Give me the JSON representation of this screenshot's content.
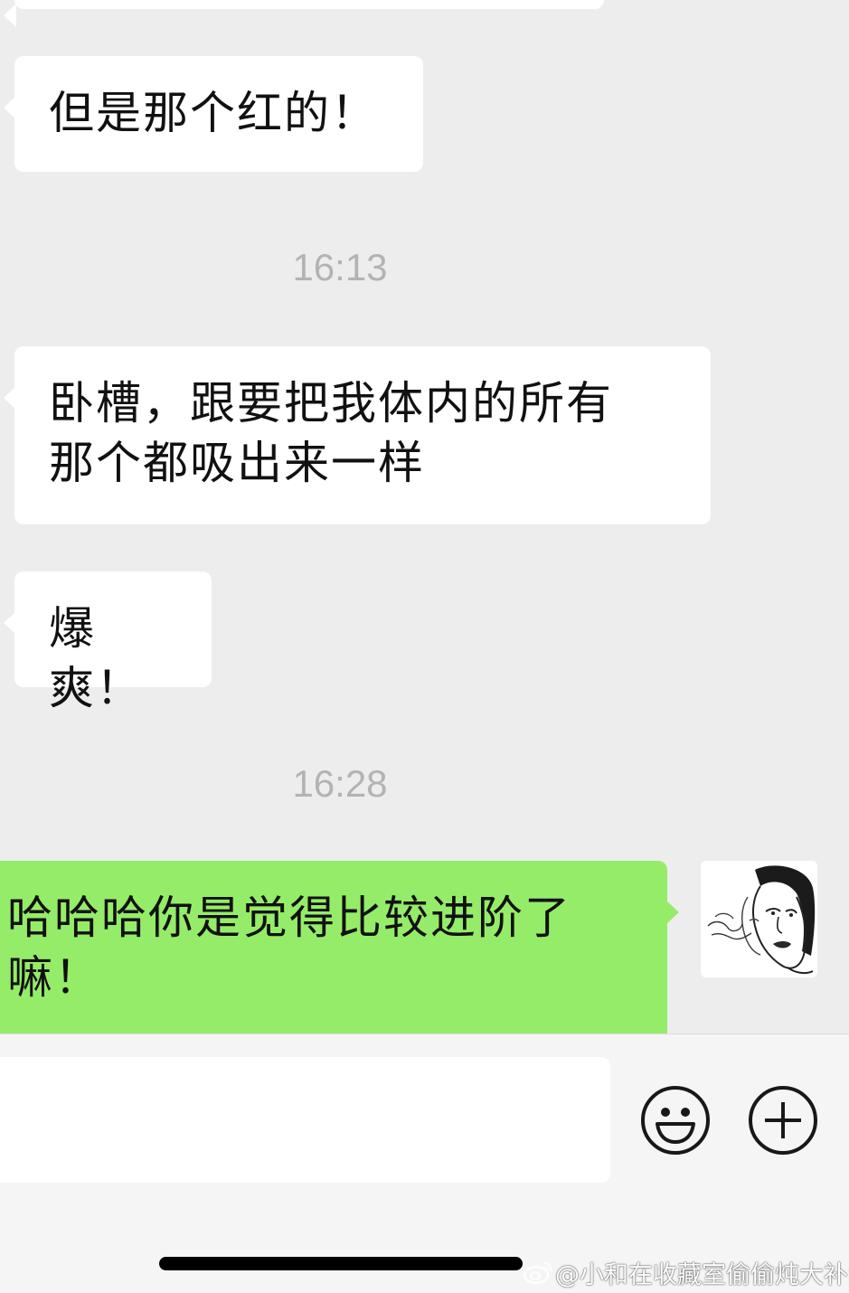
{
  "messages": [
    {
      "side": "in",
      "text": "但是那个红的！"
    },
    {
      "type": "time",
      "text": "16:13"
    },
    {
      "side": "in",
      "lines": [
        "卧槽，跟要把我体内的所有",
        "那个都吸出来一样"
      ]
    },
    {
      "side": "in",
      "text": "爆爽！"
    },
    {
      "type": "time",
      "text": "16:28"
    },
    {
      "side": "out",
      "lines": [
        "哈哈哈你是觉得比较进阶了",
        "嘛！"
      ]
    }
  ],
  "input": {
    "value": ""
  },
  "icons": {
    "emoji": "emoji-smile-icon",
    "plus": "plus-circle-icon",
    "avatar": "avatar-illustration"
  },
  "watermark": {
    "text": "@小和在收藏室偷偷炖大补汤"
  },
  "colors": {
    "background": "#ededed",
    "incoming_bubble": "#ffffff",
    "outgoing_bubble": "#95ec69",
    "timestamp": "#b3b3b3",
    "input_bar": "#f5f5f5"
  }
}
